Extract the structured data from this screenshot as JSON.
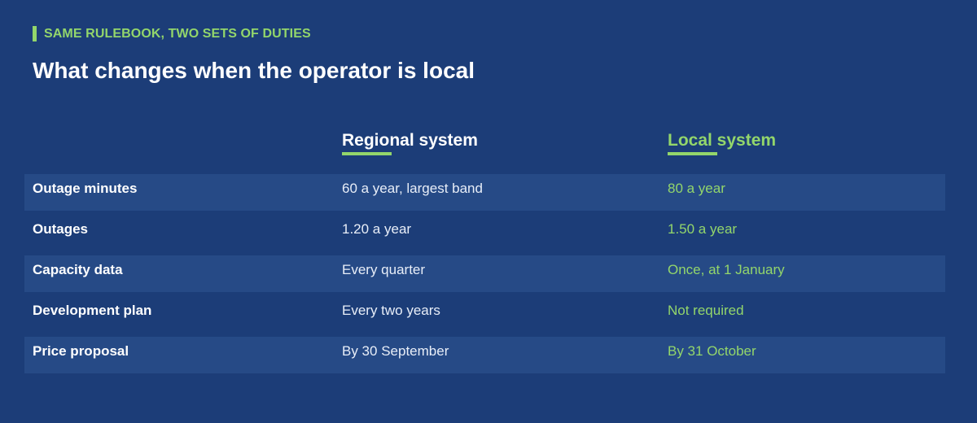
{
  "header": {
    "eyebrow": "SAME RULEBOOK, TWO SETS OF DUTIES",
    "title": "What changes when the operator is local"
  },
  "columns": {
    "regional": "Regional system",
    "local": "Local system"
  },
  "colors": {
    "background": "#1c3d78",
    "row_shade": "#264a86",
    "accent_green": "#93d66b",
    "text_white": "#ffffff"
  },
  "rows": [
    {
      "label": "Outage minutes",
      "regional": "60 a year, largest band",
      "local": "80 a year"
    },
    {
      "label": "Outages",
      "regional": "1.20 a year",
      "local": "1.50 a year"
    },
    {
      "label": "Capacity data",
      "regional": "Every quarter",
      "local": "Once, at 1 January"
    },
    {
      "label": "Development plan",
      "regional": "Every two years",
      "local": "Not required"
    },
    {
      "label": "Price proposal",
      "regional": "By 30 September",
      "local": "By 31 October"
    }
  ]
}
